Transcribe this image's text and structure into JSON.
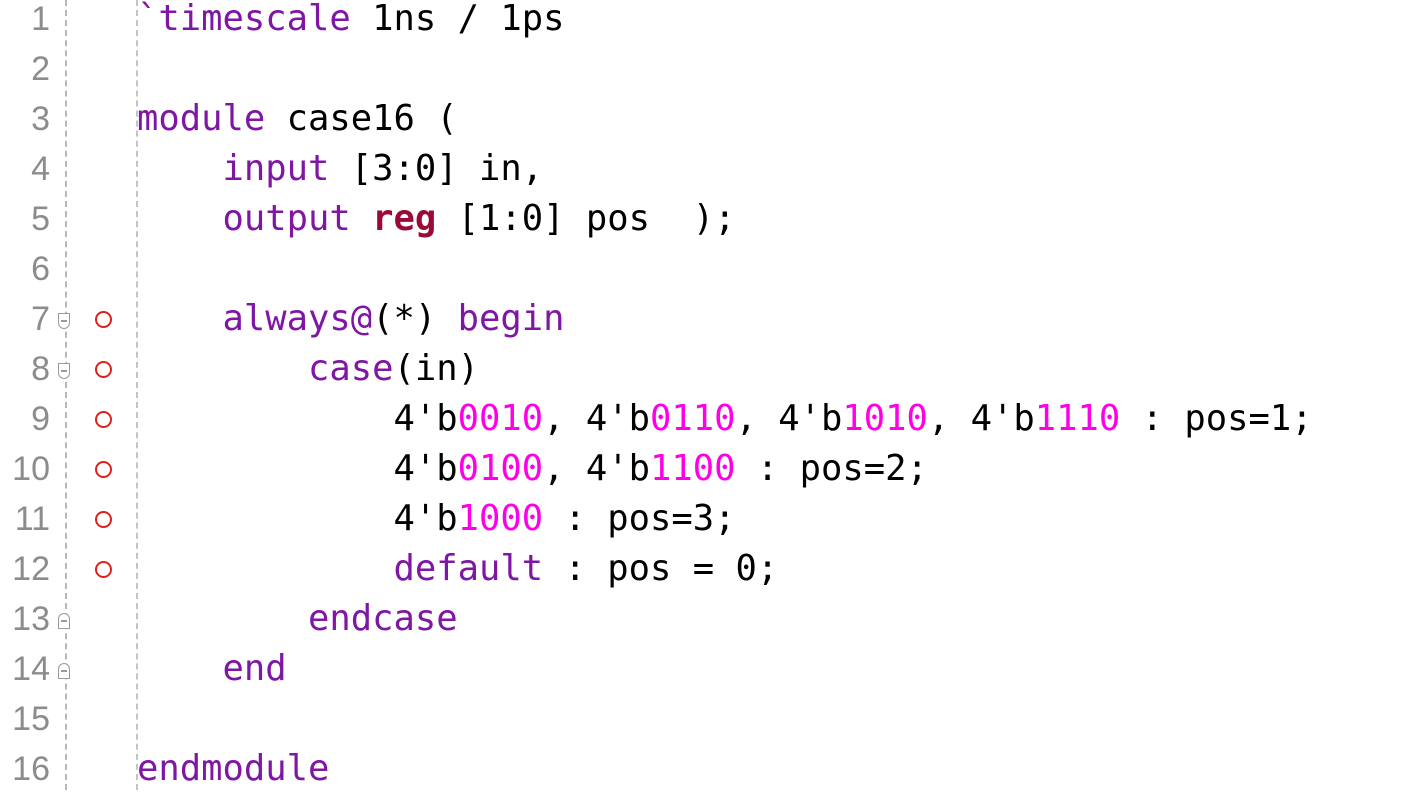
{
  "colors": {
    "keyword": "#7f16a4",
    "reg_keyword": "#9b0a36",
    "number": "#ff00e6",
    "plain": "#000000",
    "line_number": "#8c8c8c",
    "breakpoint": "#e0201c"
  },
  "lines": [
    {
      "n": "1",
      "fold": null,
      "bp": false,
      "tokens": [
        {
          "c": "kw",
          "t": "`timescale"
        },
        {
          "c": "plain",
          "t": " 1ns / 1ps"
        }
      ]
    },
    {
      "n": "2",
      "fold": null,
      "bp": false,
      "tokens": []
    },
    {
      "n": "3",
      "fold": null,
      "bp": false,
      "tokens": [
        {
          "c": "kw",
          "t": "module"
        },
        {
          "c": "plain",
          "t": " case16 ("
        }
      ]
    },
    {
      "n": "4",
      "fold": null,
      "bp": false,
      "tokens": [
        {
          "c": "plain",
          "t": "    "
        },
        {
          "c": "kw",
          "t": "input"
        },
        {
          "c": "plain",
          "t": " [3:0] in,"
        }
      ]
    },
    {
      "n": "5",
      "fold": null,
      "bp": false,
      "tokens": [
        {
          "c": "plain",
          "t": "    "
        },
        {
          "c": "kw",
          "t": "output"
        },
        {
          "c": "plain",
          "t": " "
        },
        {
          "c": "reg",
          "t": "reg"
        },
        {
          "c": "plain",
          "t": " [1:0] pos  );"
        }
      ]
    },
    {
      "n": "6",
      "fold": null,
      "bp": false,
      "tokens": []
    },
    {
      "n": "7",
      "fold": "open",
      "bp": true,
      "tokens": [
        {
          "c": "plain",
          "t": "    "
        },
        {
          "c": "kw",
          "t": "always@"
        },
        {
          "c": "plain",
          "t": "(*) "
        },
        {
          "c": "kw",
          "t": "begin"
        }
      ]
    },
    {
      "n": "8",
      "fold": "open",
      "bp": true,
      "tokens": [
        {
          "c": "plain",
          "t": "        "
        },
        {
          "c": "kw",
          "t": "case"
        },
        {
          "c": "plain",
          "t": "(in)"
        }
      ]
    },
    {
      "n": "9",
      "fold": null,
      "bp": true,
      "tokens": [
        {
          "c": "plain",
          "t": "            4'b"
        },
        {
          "c": "num",
          "t": "0010"
        },
        {
          "c": "plain",
          "t": ", 4'b"
        },
        {
          "c": "num",
          "t": "0110"
        },
        {
          "c": "plain",
          "t": ", 4'b"
        },
        {
          "c": "num",
          "t": "1010"
        },
        {
          "c": "plain",
          "t": ", 4'b"
        },
        {
          "c": "num",
          "t": "1110"
        },
        {
          "c": "plain",
          "t": " : pos=1;"
        }
      ]
    },
    {
      "n": "10",
      "fold": null,
      "bp": true,
      "tokens": [
        {
          "c": "plain",
          "t": "            4'b"
        },
        {
          "c": "num",
          "t": "0100"
        },
        {
          "c": "plain",
          "t": ", 4'b"
        },
        {
          "c": "num",
          "t": "1100"
        },
        {
          "c": "plain",
          "t": " : pos=2;"
        }
      ]
    },
    {
      "n": "11",
      "fold": null,
      "bp": true,
      "tokens": [
        {
          "c": "plain",
          "t": "            4'b"
        },
        {
          "c": "num",
          "t": "1000"
        },
        {
          "c": "plain",
          "t": " : pos=3;"
        }
      ]
    },
    {
      "n": "12",
      "fold": null,
      "bp": true,
      "tokens": [
        {
          "c": "plain",
          "t": "            "
        },
        {
          "c": "kw",
          "t": "default"
        },
        {
          "c": "plain",
          "t": " : pos = 0;"
        }
      ]
    },
    {
      "n": "13",
      "fold": "close",
      "bp": false,
      "tokens": [
        {
          "c": "plain",
          "t": "        "
        },
        {
          "c": "kw",
          "t": "endcase"
        }
      ]
    },
    {
      "n": "14",
      "fold": "close",
      "bp": false,
      "tokens": [
        {
          "c": "plain",
          "t": "    "
        },
        {
          "c": "kw",
          "t": "end"
        }
      ]
    },
    {
      "n": "15",
      "fold": null,
      "bp": false,
      "tokens": []
    },
    {
      "n": "16",
      "fold": null,
      "bp": false,
      "tokens": [
        {
          "c": "kw",
          "t": "endmodule"
        }
      ]
    }
  ]
}
